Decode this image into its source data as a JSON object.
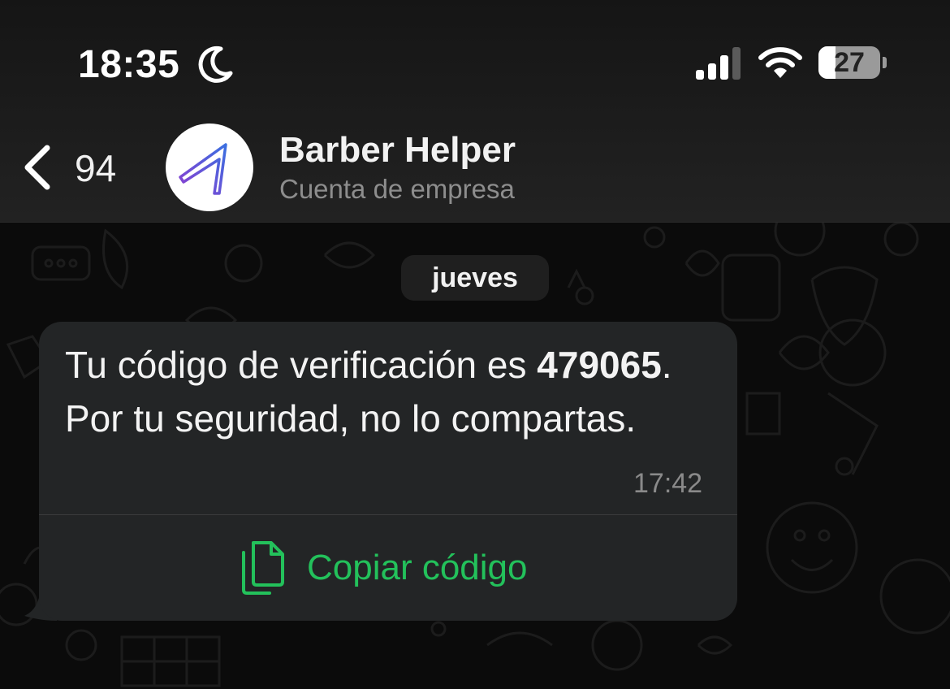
{
  "status_bar": {
    "time": "18:35",
    "battery_level": "27",
    "battery_fraction": 0.27,
    "icons": [
      "moon-icon",
      "signal-icon",
      "wifi-icon",
      "battery-icon"
    ]
  },
  "header": {
    "back_count": "94",
    "contact_name": "Barber Helper",
    "contact_subtitle": "Cuenta de empresa"
  },
  "chat": {
    "date_label": "jueves",
    "message": {
      "text_before": "Tu código de verificación es ",
      "code": "479065",
      "text_after": ". Por tu seguridad, no lo compartas.",
      "time": "17:42",
      "copy_button_label": "Copiar código"
    }
  },
  "colors": {
    "accent_green": "#23c15b",
    "bubble_bg": "#232526",
    "background": "#0b0b0b"
  }
}
